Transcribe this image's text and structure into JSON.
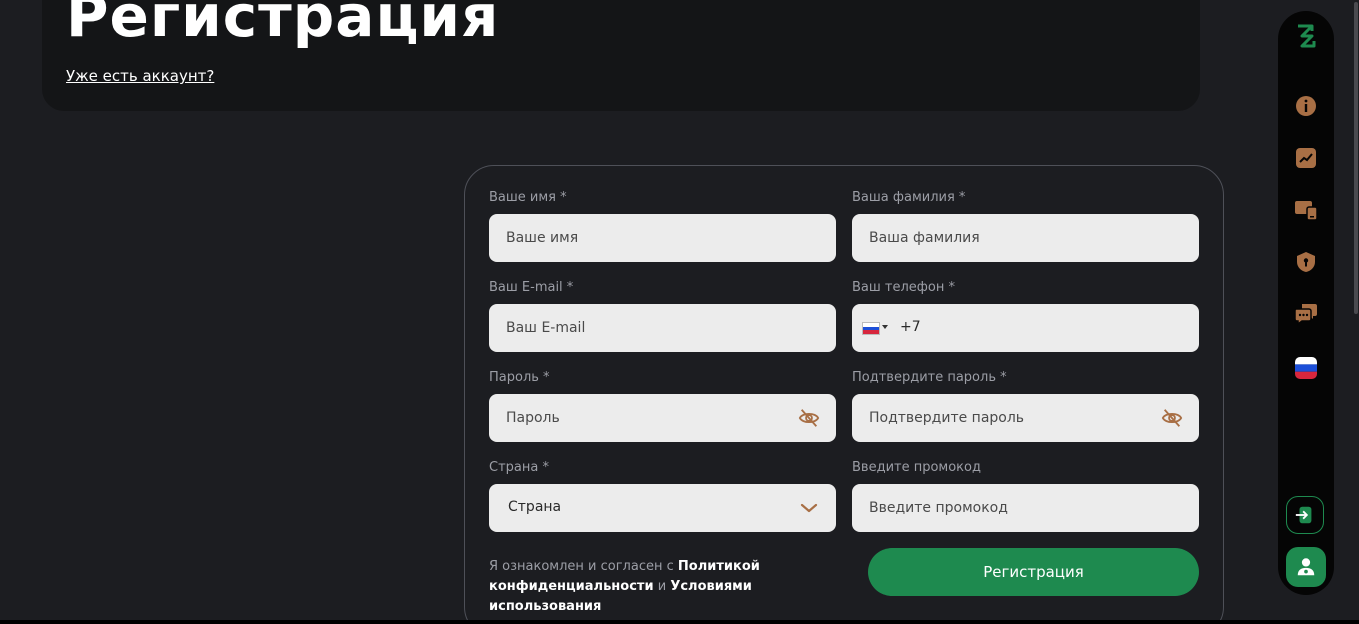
{
  "header": {
    "title": "Регистрация",
    "login_link": "Уже есть аккаунт?"
  },
  "form": {
    "first_name": {
      "label": "Ваше имя *",
      "placeholder": "Ваше имя"
    },
    "last_name": {
      "label": "Ваша фамилия *",
      "placeholder": "Ваша фамилия"
    },
    "email": {
      "label": "Ваш E-mail *",
      "placeholder": "Ваш E-mail"
    },
    "phone": {
      "label": "Ваш телефон *",
      "value": "+7"
    },
    "password": {
      "label": "Пароль *",
      "placeholder": "Пароль"
    },
    "password_confirm": {
      "label": "Подтвердите пароль *",
      "placeholder": "Подтвердите пароль"
    },
    "country": {
      "label": "Страна *",
      "value": "Страна"
    },
    "promo": {
      "label": "Введите промокод",
      "placeholder": "Введите промокод"
    },
    "consent": {
      "prefix": "Я ознакомлен и согласен с",
      "privacy_link": "Политикой конфиденциальности",
      "conjunction": "и",
      "terms_link": "Условиями использования"
    },
    "submit_label": "Регистрация"
  },
  "rail": {
    "items": [
      {
        "icon": "info-icon"
      },
      {
        "icon": "chart-icon"
      },
      {
        "icon": "devices-icon"
      },
      {
        "icon": "shield-icon"
      },
      {
        "icon": "chat-icon"
      },
      {
        "icon": "russian-flag-icon"
      }
    ],
    "login_icon": "login-icon",
    "profile_icon": "user-icon"
  },
  "colors": {
    "background": "#1c1d21",
    "card": "#141517",
    "accent_green": "#1e8a4f",
    "icon_brown": "#a86f45",
    "input_bg": "#ececec"
  }
}
